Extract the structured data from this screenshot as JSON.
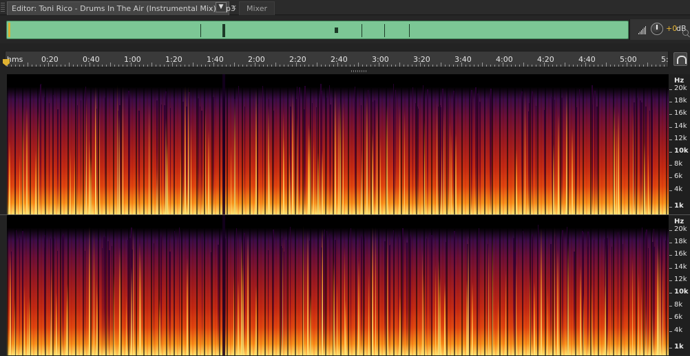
{
  "tabs": {
    "editor_label": "Editor: Toni Rico - Drums In The Air (Instrumental Mix).mp3",
    "dropdown_glyph": "▼",
    "close_glyph": "×",
    "mixer_label": "Mixer"
  },
  "volume": {
    "value": "+0",
    "unit": "dB"
  },
  "ruler": {
    "labels": [
      "hms",
      "0:20",
      "0:40",
      "1:00",
      "1:20",
      "1:40",
      "2:00",
      "2:20",
      "2:40",
      "3:00",
      "3:20",
      "3:40",
      "4:00",
      "4:20",
      "4:40",
      "5:00",
      "5:"
    ]
  },
  "hz_axis": {
    "labels": [
      "Hz",
      "20k",
      "18k",
      "16k",
      "14k",
      "12k",
      "10k",
      "8k",
      "6k",
      "4k",
      "1k"
    ]
  },
  "icons": {
    "grip": "panel-grip-icon",
    "dropdown": "dropdown-arrow-icon",
    "close": "close-icon",
    "volume_meter": "volume-meter-icon",
    "knob": "volume-knob-icon",
    "zoom": "zoom-icon",
    "playhead": "playhead-marker-icon",
    "snap": "headphones-icon"
  },
  "colors": {
    "overview_fill": "#7cc795",
    "playhead": "#e0b231",
    "volume_value": "#e8b534",
    "spectrum_low": "#ffe070",
    "spectrum_high": "#3c0c48"
  }
}
